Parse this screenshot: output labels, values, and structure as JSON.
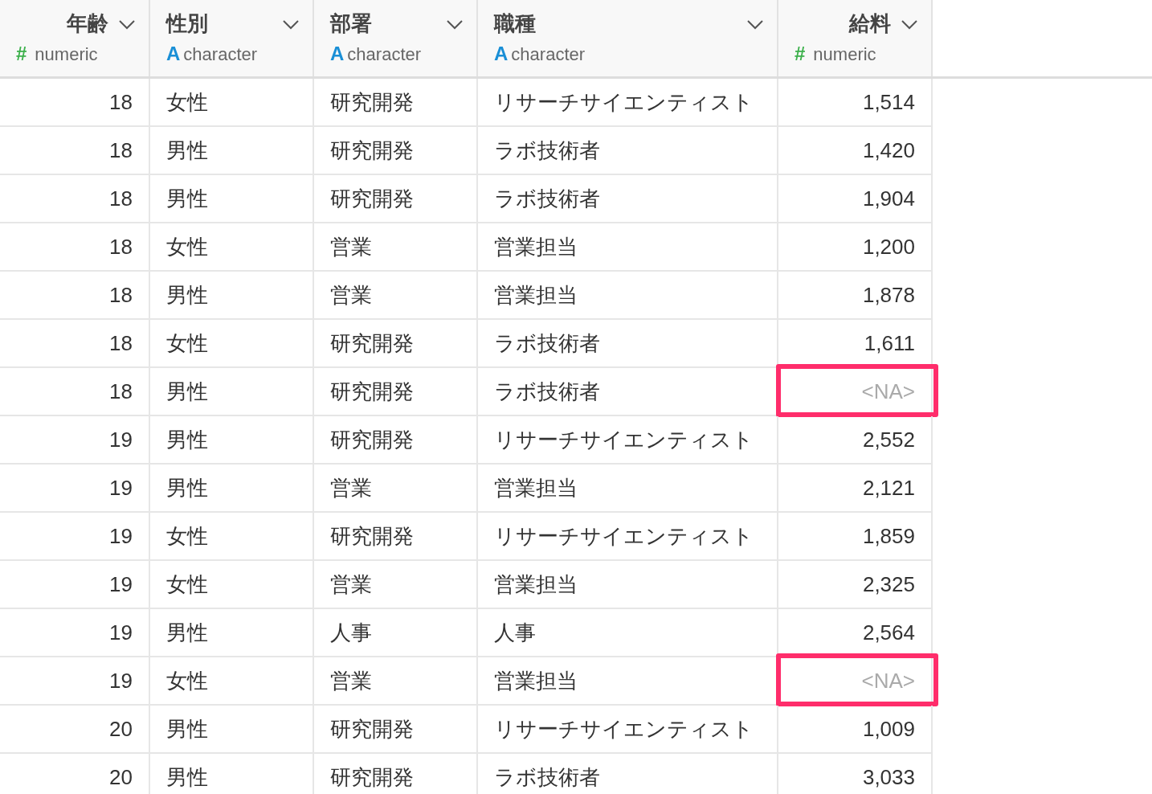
{
  "columns": [
    {
      "name": "年齢",
      "kind": "numeric",
      "type_icon": "#",
      "type": "numeric"
    },
    {
      "name": "性別",
      "kind": "character",
      "type_icon": "A",
      "type": "character"
    },
    {
      "name": "部署",
      "kind": "character",
      "type_icon": "A",
      "type": "character"
    },
    {
      "name": "職種",
      "kind": "character",
      "type_icon": "A",
      "type": "character"
    },
    {
      "name": "給料",
      "kind": "numeric",
      "type_icon": "#",
      "type": "numeric"
    }
  ],
  "rows": [
    {
      "cells": [
        "18",
        "女性",
        "研究開発",
        "リサーチサイエンティスト",
        "1,514"
      ],
      "salary_missing": false,
      "highlighted": false
    },
    {
      "cells": [
        "18",
        "男性",
        "研究開発",
        "ラボ技術者",
        "1,420"
      ],
      "salary_missing": false,
      "highlighted": false
    },
    {
      "cells": [
        "18",
        "男性",
        "研究開発",
        "ラボ技術者",
        "1,904"
      ],
      "salary_missing": false,
      "highlighted": false
    },
    {
      "cells": [
        "18",
        "女性",
        "営業",
        "営業担当",
        "1,200"
      ],
      "salary_missing": false,
      "highlighted": false
    },
    {
      "cells": [
        "18",
        "男性",
        "営業",
        "営業担当",
        "1,878"
      ],
      "salary_missing": false,
      "highlighted": false
    },
    {
      "cells": [
        "18",
        "女性",
        "研究開発",
        "ラボ技術者",
        "1,611"
      ],
      "salary_missing": false,
      "highlighted": false
    },
    {
      "cells": [
        "18",
        "男性",
        "研究開発",
        "ラボ技術者",
        "<NA>"
      ],
      "salary_missing": true,
      "highlighted": true
    },
    {
      "cells": [
        "19",
        "男性",
        "研究開発",
        "リサーチサイエンティスト",
        "2,552"
      ],
      "salary_missing": false,
      "highlighted": false
    },
    {
      "cells": [
        "19",
        "男性",
        "営業",
        "営業担当",
        "2,121"
      ],
      "salary_missing": false,
      "highlighted": false
    },
    {
      "cells": [
        "19",
        "女性",
        "研究開発",
        "リサーチサイエンティスト",
        "1,859"
      ],
      "salary_missing": false,
      "highlighted": false
    },
    {
      "cells": [
        "19",
        "女性",
        "営業",
        "営業担当",
        "2,325"
      ],
      "salary_missing": false,
      "highlighted": false
    },
    {
      "cells": [
        "19",
        "男性",
        "人事",
        "人事",
        "2,564"
      ],
      "salary_missing": false,
      "highlighted": false
    },
    {
      "cells": [
        "19",
        "女性",
        "営業",
        "営業担当",
        "<NA>"
      ],
      "salary_missing": true,
      "highlighted": true
    },
    {
      "cells": [
        "20",
        "男性",
        "研究開発",
        "リサーチサイエンティスト",
        "1,009"
      ],
      "salary_missing": false,
      "highlighted": false
    },
    {
      "cells": [
        "20",
        "男性",
        "研究開発",
        "ラボ技術者",
        "3,033"
      ],
      "salary_missing": false,
      "highlighted": false
    }
  ]
}
